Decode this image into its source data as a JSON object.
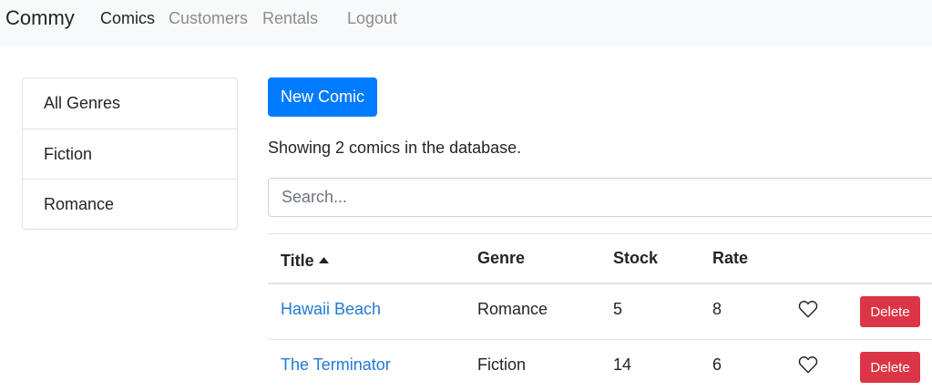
{
  "navbar": {
    "brand": "Commy",
    "links": [
      {
        "label": "Comics",
        "active": true
      },
      {
        "label": "Customers",
        "active": false
      },
      {
        "label": "Rentals",
        "active": false
      },
      {
        "label": "Logout",
        "active": false
      }
    ]
  },
  "sidebar": {
    "genres": [
      "All Genres",
      "Fiction",
      "Romance"
    ]
  },
  "main": {
    "new_button": "New Comic",
    "summary": "Showing 2 comics in the database.",
    "search_placeholder": "Search..."
  },
  "table": {
    "headers": [
      "Title",
      "Genre",
      "Stock",
      "Rate"
    ],
    "sort_icon": "caret-up-icon",
    "rows": [
      {
        "title": "Hawaii Beach",
        "genre": "Romance",
        "stock": "5",
        "rate": "8",
        "delete": "Delete"
      },
      {
        "title": "The Terminator",
        "genre": "Fiction",
        "stock": "14",
        "rate": "6",
        "delete": "Delete"
      }
    ]
  },
  "colors": {
    "primary": "#007bff",
    "danger": "#dc3545",
    "link": "#1f7ad6",
    "navbar_bg": "#f8f9fa"
  }
}
